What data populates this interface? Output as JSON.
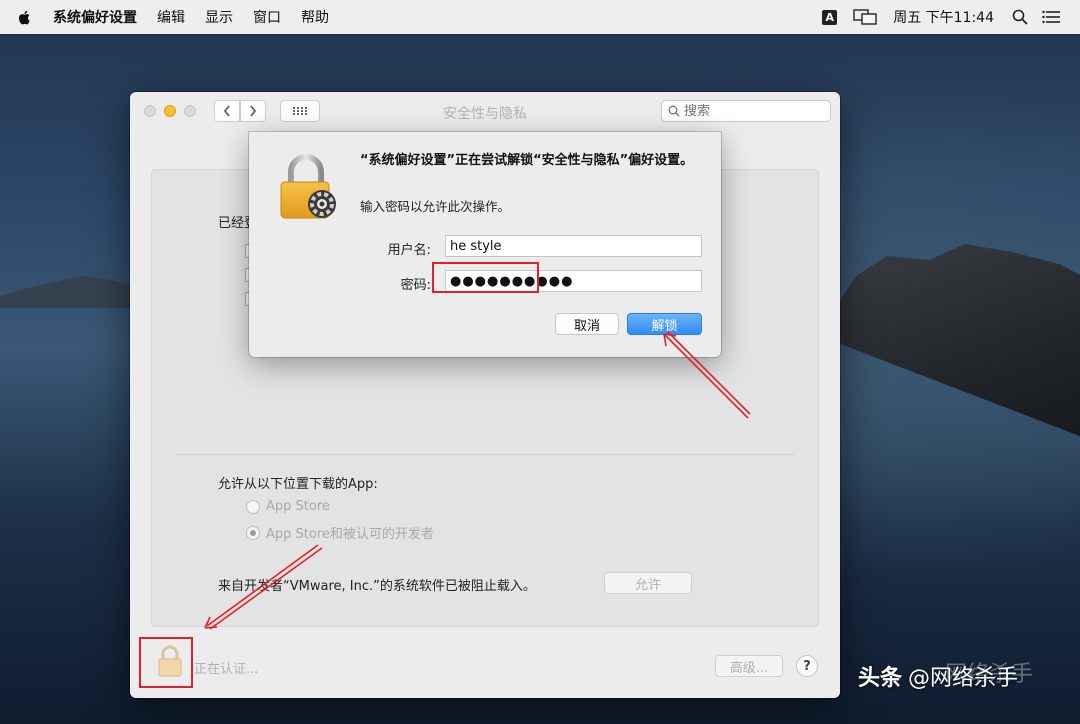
{
  "menubar": {
    "app_name": "系统偏好设置",
    "menus": [
      "编辑",
      "显示",
      "窗口",
      "帮助"
    ],
    "input_method": "A",
    "clock": "周五 下午11:44"
  },
  "window": {
    "title": "安全性与隐私",
    "search_placeholder": "搜索",
    "already_label": "已经登",
    "allow_apps_label": "允许从以下位置下载的App:",
    "radio_options": [
      {
        "label": "App Store",
        "selected": false
      },
      {
        "label": "App Store和被认可的开发者",
        "selected": true
      }
    ],
    "blocked_message": "来自开发者“VMware, Inc.”的系统软件已被阻止载入。",
    "allow_button": "允许",
    "auth_status": "正在认证...",
    "advanced_button": "高级...",
    "help_button": "?"
  },
  "dialog": {
    "message": "“系统偏好设置”正在尝试解锁“安全性与隐私”偏好设置。",
    "sub_message": "输入密码以允许此次操作。",
    "username_label": "用户名:",
    "username_value": "he style",
    "password_label": "密码:",
    "password_value": "●●●●●●●●●●",
    "cancel_button": "取消",
    "unlock_button": "解锁"
  },
  "watermark": {
    "logo": "头条",
    "account": "@网络杀手"
  },
  "colors": {
    "accent": "#2f8df6",
    "annotation_red": "#e0202a"
  }
}
